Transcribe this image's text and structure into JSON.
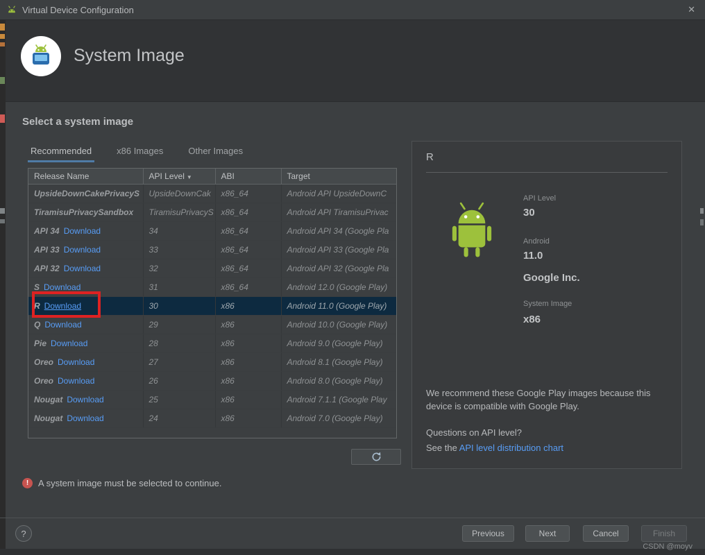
{
  "colors": {
    "link_blue": "#589df6",
    "selection_bg": "#0d2a40",
    "annotation_red": "#dd2222",
    "android_green": "#9dc13c",
    "error_red": "#c75450"
  },
  "titlebar": {
    "title": "Virtual Device Configuration",
    "close": "✕"
  },
  "header": {
    "title": "System Image"
  },
  "content": {
    "section_title": "Select a system image",
    "tabs": [
      {
        "label": "Recommended"
      },
      {
        "label": "x86 Images"
      },
      {
        "label": "Other Images"
      }
    ],
    "active_tab": "Recommended"
  },
  "table": {
    "columns": [
      "Release Name",
      "API Level",
      "ABI",
      "Target"
    ],
    "sort_column": "API Level",
    "sort_icon": "▼",
    "download_label": "Download",
    "rows": [
      {
        "name": "UpsideDownCakePrivacyS",
        "download": false,
        "api": "UpsideDownCak",
        "abi": "x86_64",
        "target": "Android API UpsideDownC",
        "selected": false
      },
      {
        "name": "TiramisuPrivacySandbox",
        "download": false,
        "api": "TiramisuPrivacyS",
        "abi": "x86_64",
        "target": "Android API TiramisuPrivac",
        "selected": false
      },
      {
        "name": "API 34",
        "download": true,
        "api": "34",
        "abi": "x86_64",
        "target": "Android API 34 (Google Pla",
        "selected": false
      },
      {
        "name": "API 33",
        "download": true,
        "api": "33",
        "abi": "x86_64",
        "target": "Android API 33 (Google Pla",
        "selected": false
      },
      {
        "name": "API 32",
        "download": true,
        "api": "32",
        "abi": "x86_64",
        "target": "Android API 32 (Google Pla",
        "selected": false
      },
      {
        "name": "S",
        "download": true,
        "api": "31",
        "abi": "x86_64",
        "target": "Android 12.0 (Google Play)",
        "selected": false
      },
      {
        "name": "R",
        "download": true,
        "api": "30",
        "abi": "x86",
        "target": "Android 11.0 (Google Play)",
        "selected": true
      },
      {
        "name": "Q",
        "download": true,
        "api": "29",
        "abi": "x86",
        "target": "Android 10.0 (Google Play)",
        "selected": false
      },
      {
        "name": "Pie",
        "download": true,
        "api": "28",
        "abi": "x86",
        "target": "Android 9.0 (Google Play)",
        "selected": false
      },
      {
        "name": "Oreo",
        "download": true,
        "api": "27",
        "abi": "x86",
        "target": "Android 8.1 (Google Play)",
        "selected": false
      },
      {
        "name": "Oreo",
        "download": true,
        "api": "26",
        "abi": "x86",
        "target": "Android 8.0 (Google Play)",
        "selected": false
      },
      {
        "name": "Nougat",
        "download": true,
        "api": "25",
        "abi": "x86",
        "target": "Android 7.1.1 (Google Play",
        "selected": false
      },
      {
        "name": "Nougat",
        "download": true,
        "api": "24",
        "abi": "x86",
        "target": "Android 7.0 (Google Play)",
        "selected": false
      }
    ]
  },
  "details": {
    "title": "R",
    "api_level_label": "API Level",
    "api_level_value": "30",
    "android_label": "Android",
    "android_value": "11.0",
    "vendor": "Google Inc.",
    "system_image_label": "System Image",
    "system_image_value": "x86",
    "recommendation": "We recommend these Google Play images because this device is compatible with Google Play.",
    "question": "Questions on API level?",
    "see_prefix": "See the ",
    "link_label": "API level distribution chart"
  },
  "footer": {
    "error_icon": "!",
    "error_message": "A system image must be selected to continue.",
    "help_label": "?",
    "buttons": [
      {
        "label": "Previous",
        "enabled": true
      },
      {
        "label": "Next",
        "enabled": true
      },
      {
        "label": "Cancel",
        "enabled": true
      },
      {
        "label": "Finish",
        "enabled": false
      }
    ],
    "watermark": "CSDN @moyv"
  }
}
